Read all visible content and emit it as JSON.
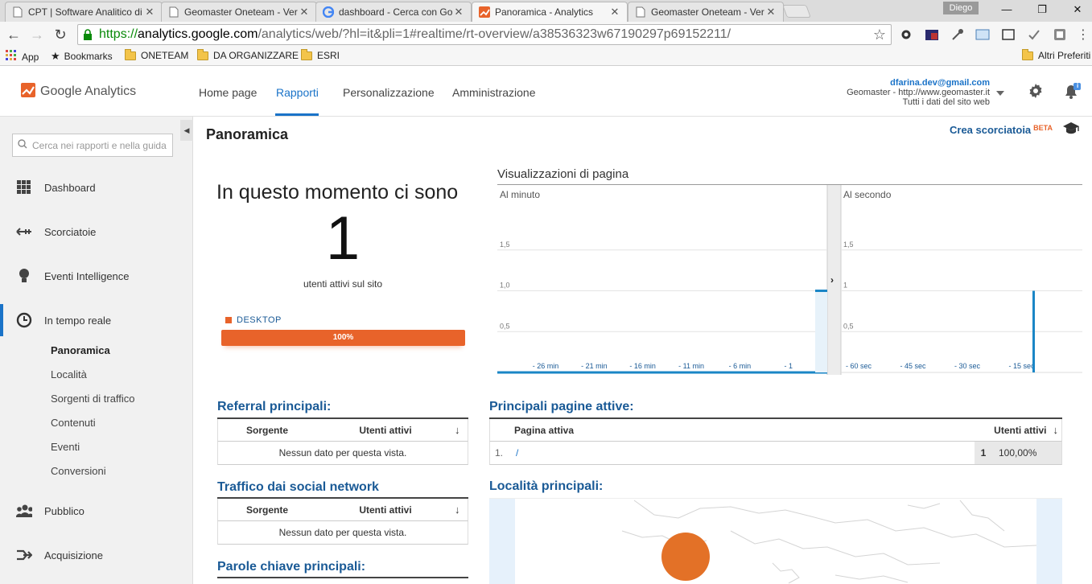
{
  "browser": {
    "tabs": [
      {
        "title": "CPT | Software Analitico di"
      },
      {
        "title": "Geomaster Oneteam - Ver"
      },
      {
        "title": "dashboard - Cerca con Go"
      },
      {
        "title": "Panoramica - Analytics"
      },
      {
        "title": "Geomaster Oneteam - Ver"
      }
    ],
    "user": "Diego",
    "url_scheme": "https://",
    "url_host": "analytics.google.com",
    "url_path": "/analytics/web/?hl=it&pli=1#realtime/rt-overview/a38536323w67190297p69152211/",
    "bookmarks": {
      "apps": "App",
      "bookmarks": "Bookmarks",
      "folders": [
        "ONETEAM",
        "DA ORGANIZZARE",
        "ESRI"
      ],
      "other": "Altri Preferiti"
    }
  },
  "ga": {
    "logo": "Google Analytics",
    "nav": [
      "Home page",
      "Rapporti",
      "Personalizzazione",
      "Amministrazione"
    ],
    "account": {
      "email": "dfarina.dev@gmail.com",
      "property": "Geomaster - http://www.geomaster.it",
      "view": "Tutti i dati del sito web"
    },
    "notification_count": "i"
  },
  "sidebar": {
    "search_placeholder": "Cerca nei rapporti e nella guida",
    "items": [
      {
        "label": "Dashboard"
      },
      {
        "label": "Scorciatoie"
      },
      {
        "label": "Eventi Intelligence"
      },
      {
        "label": "In tempo reale"
      },
      {
        "label": "Pubblico"
      },
      {
        "label": "Acquisizione"
      }
    ],
    "subitems": [
      "Panoramica",
      "Località",
      "Sorgenti di traffico",
      "Contenuti",
      "Eventi",
      "Conversioni"
    ]
  },
  "main": {
    "title": "Panoramica",
    "shortcut": "Crea scorciatoia",
    "beta": "BETA",
    "now_title": "In questo momento ci sono",
    "active_users": "1",
    "active_users_label": "utenti attivi sul sito",
    "device_label": "DESKTOP",
    "device_percent": "100%",
    "device_share": 1.0,
    "pageviews_title": "Visualizzazioni di pagina",
    "referral_title": "Referral principali:",
    "social_title": "Traffico dai social network",
    "keywords_title": "Parole chiave principali:",
    "pages_title": "Principali pagine attive:",
    "locations_title": "Località principali:",
    "col_source": "Sorgente",
    "col_active_users": "Utenti attivi",
    "col_active_page": "Pagina attiva",
    "no_data": "Nessun dato per questa vista.",
    "pages_rows": [
      {
        "rank": "1.",
        "page": "/",
        "users": "1",
        "percent": "100,00%"
      }
    ]
  },
  "chart_data": [
    {
      "type": "bar",
      "title": "Al minuto",
      "x_ticks": [
        "- 26 min",
        "- 21 min",
        "- 16 min",
        "- 11 min",
        "- 6 min",
        "- 1"
      ],
      "y_ticks": [
        "0,5",
        "1,0",
        "1,5"
      ],
      "ylim": [
        0,
        2
      ],
      "series": [
        {
          "x": "- 1",
          "y": 1
        }
      ]
    },
    {
      "type": "bar",
      "title": "Al secondo",
      "x_ticks": [
        "- 60 sec",
        "- 45 sec",
        "- 30 sec",
        "- 15 sec"
      ],
      "y_ticks": [
        "0,5",
        "1",
        "1,5"
      ],
      "ylim": [
        0,
        2
      ],
      "series": [
        {
          "x": "- 15 sec",
          "y": 1
        }
      ]
    }
  ]
}
